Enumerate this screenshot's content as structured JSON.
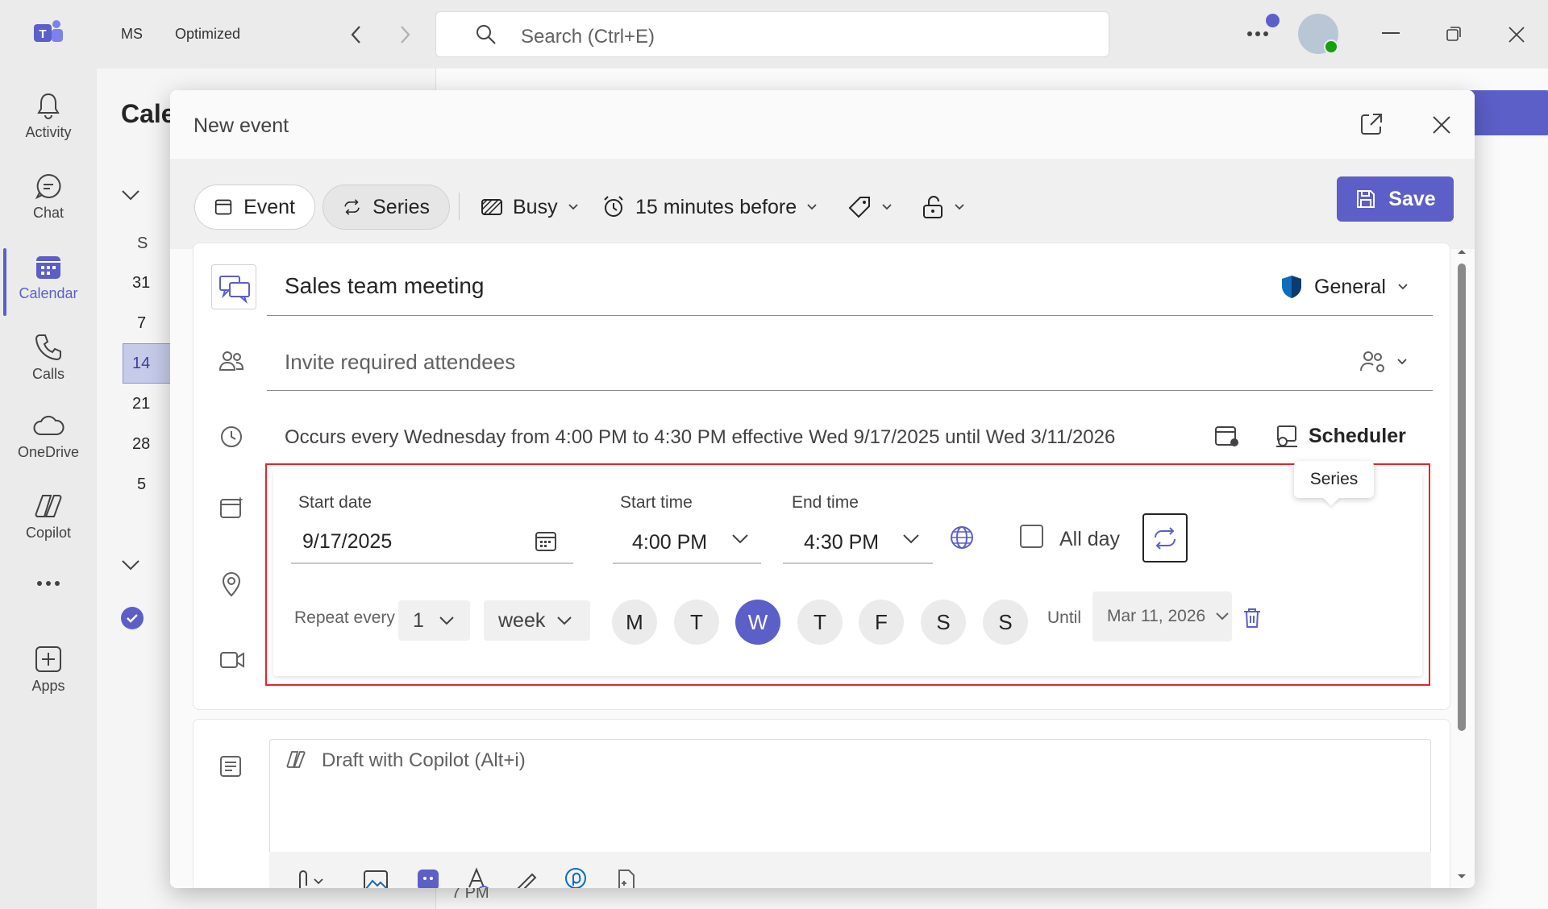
{
  "titlebar": {
    "account": "MS",
    "mode": "Optimized",
    "search_placeholder": "Search (Ctrl+E)"
  },
  "rail": {
    "items": [
      {
        "label": "Activity"
      },
      {
        "label": "Chat"
      },
      {
        "label": "Calendar"
      },
      {
        "label": "Calls"
      },
      {
        "label": "OneDrive"
      },
      {
        "label": "Copilot"
      },
      {
        "label": "..."
      },
      {
        "label": "Apps"
      }
    ]
  },
  "background": {
    "heading": "Cale",
    "dates": [
      "31",
      "7",
      "14",
      "21",
      "28",
      "5"
    ],
    "weekday": "S",
    "time_label": "7 PM"
  },
  "modal": {
    "title": "New event",
    "toolbar": {
      "event_label": "Event",
      "series_label": "Series",
      "busy_label": "Busy",
      "reminder_label": "15 minutes before",
      "save_label": "Save"
    },
    "title_value": "Sales team meeting",
    "channel_label": "General",
    "attendees_placeholder": "Invite required attendees",
    "occurrence_text": "Occurs every Wednesday from 4:00 PM to 4:30 PM effective Wed 9/17/2025 until Wed 3/11/2026",
    "scheduler_label": "Scheduler",
    "recurrence": {
      "start_date_label": "Start date",
      "start_date_value": "9/17/2025",
      "start_time_label": "Start time",
      "start_time_value": "4:00 PM",
      "end_time_label": "End time",
      "end_time_value": "4:30 PM",
      "all_day_label": "All day",
      "series_tooltip": "Series",
      "repeat_every_label": "Repeat every",
      "repeat_interval": "1",
      "repeat_unit": "week",
      "days": [
        "M",
        "T",
        "W",
        "T",
        "F",
        "S",
        "S"
      ],
      "selected_day_index": 2,
      "until_label": "Until",
      "until_value": "Mar 11, 2026"
    },
    "draft_placeholder": "Draft with Copilot (Alt+i)"
  },
  "colors": {
    "accent": "#5b5fc7",
    "highlight_border": "#e5252a"
  }
}
